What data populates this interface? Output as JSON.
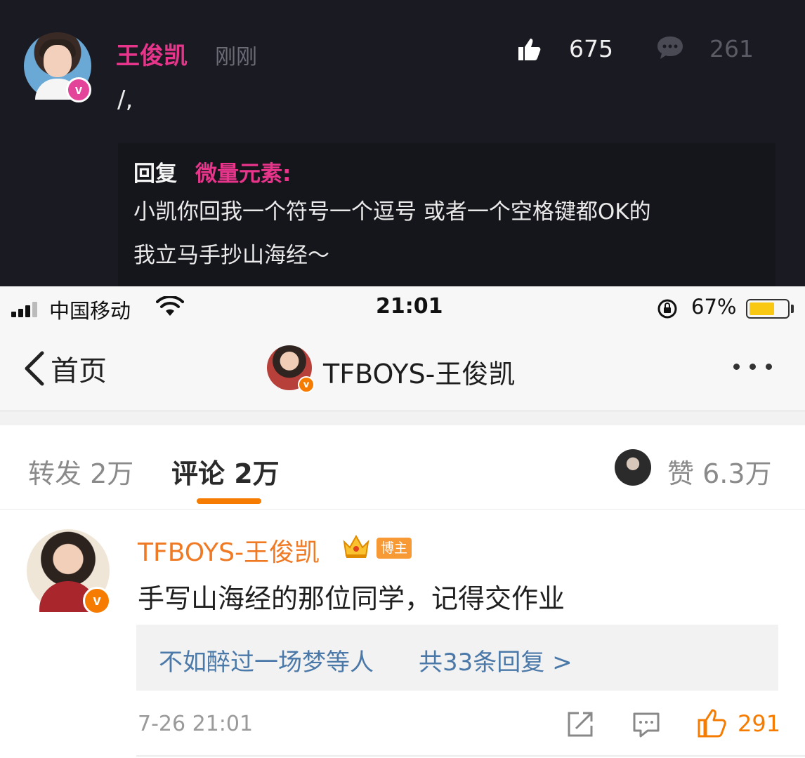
{
  "weibo_post": {
    "author": "王俊凯",
    "badge": "v",
    "time": "刚刚",
    "text": "/,",
    "likes": "675",
    "comments": "261",
    "reply": {
      "label": "回复",
      "target": "微量元素:",
      "line1": "小凯你回我一个符号一个逗号 或者一个空格键都OK的",
      "line2": "我立马手抄山海经～"
    }
  },
  "status_bar": {
    "carrier": "中国移动",
    "time": "21:01",
    "battery": "67%",
    "battery_level": 0.67
  },
  "nav": {
    "back_label": "首页",
    "title": "TFBOYS-王俊凯",
    "badge": "v"
  },
  "tabs": {
    "repost": "转发 2万",
    "comment": "评论 2万",
    "likes": "赞 6.3万"
  },
  "comment": {
    "author": "TFBOYS-王俊凯",
    "badge": "v",
    "tag": "博主",
    "text": "手写山海经的那位同学，记得交作业",
    "reply_user": "不如醉过一场梦等人",
    "reply_count": "共33条回复 >",
    "time": "7-26 21:01",
    "likes": "291"
  },
  "colors": {
    "pink_accent": "#e6358a",
    "orange_accent": "#f57c00",
    "link_blue": "#4a78a8",
    "dark_bg": "#1a1a23"
  }
}
